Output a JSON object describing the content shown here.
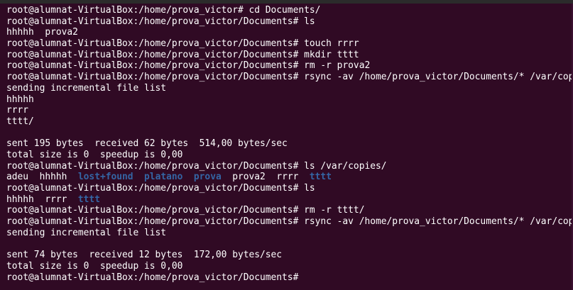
{
  "terminal": {
    "lines": [
      {
        "text": "root@alumnat-VirtualBox:/home/prova_victor# cd Documents/"
      },
      {
        "text": "root@alumnat-VirtualBox:/home/prova_victor/Documents# ls"
      },
      {
        "text": "hhhhh  prova2"
      },
      {
        "text": "root@alumnat-VirtualBox:/home/prova_victor/Documents# touch rrrr"
      },
      {
        "text": "root@alumnat-VirtualBox:/home/prova_victor/Documents# mkdir tttt"
      },
      {
        "text": "root@alumnat-VirtualBox:/home/prova_victor/Documents# rm -r prova2"
      },
      {
        "text": "root@alumnat-VirtualBox:/home/prova_victor/Documents# rsync -av /home/prova_victor/Documents/* /var/copies/"
      },
      {
        "text": "sending incremental file list"
      },
      {
        "text": "hhhhh"
      },
      {
        "text": "rrrr"
      },
      {
        "text": "tttt/"
      },
      {
        "text": ""
      },
      {
        "text": "sent 195 bytes  received 62 bytes  514,00 bytes/sec"
      },
      {
        "text": "total size is 0  speedup is 0,00"
      },
      {
        "text": "root@alumnat-VirtualBox:/home/prova_victor/Documents# ls /var/copies/"
      },
      {
        "segments": [
          {
            "text": "adeu  hhhhh  ",
            "dir": false
          },
          {
            "text": "lost+found",
            "dir": true
          },
          {
            "text": "  ",
            "dir": false
          },
          {
            "text": "platano",
            "dir": true
          },
          {
            "text": "  ",
            "dir": false
          },
          {
            "text": "prova",
            "dir": true
          },
          {
            "text": "  prova2  rrrr  ",
            "dir": false
          },
          {
            "text": "tttt",
            "dir": true
          }
        ]
      },
      {
        "text": "root@alumnat-VirtualBox:/home/prova_victor/Documents# ls"
      },
      {
        "segments": [
          {
            "text": "hhhhh  rrrr  ",
            "dir": false
          },
          {
            "text": "tttt",
            "dir": true
          }
        ]
      },
      {
        "text": "root@alumnat-VirtualBox:/home/prova_victor/Documents# rm -r tttt/"
      },
      {
        "text": "root@alumnat-VirtualBox:/home/prova_victor/Documents# rsync -av /home/prova_victor/Documents/* /var/copies/"
      },
      {
        "text": "sending incremental file list"
      },
      {
        "text": ""
      },
      {
        "text": "sent 74 bytes  received 12 bytes  172,00 bytes/sec"
      },
      {
        "text": "total size is 0  speedup is 0,00"
      },
      {
        "text": "root@alumnat-VirtualBox:/home/prova_victor/Documents# "
      }
    ]
  },
  "colors": {
    "background": "#300a24",
    "text": "#ffffff",
    "directory": "#3465a4"
  }
}
